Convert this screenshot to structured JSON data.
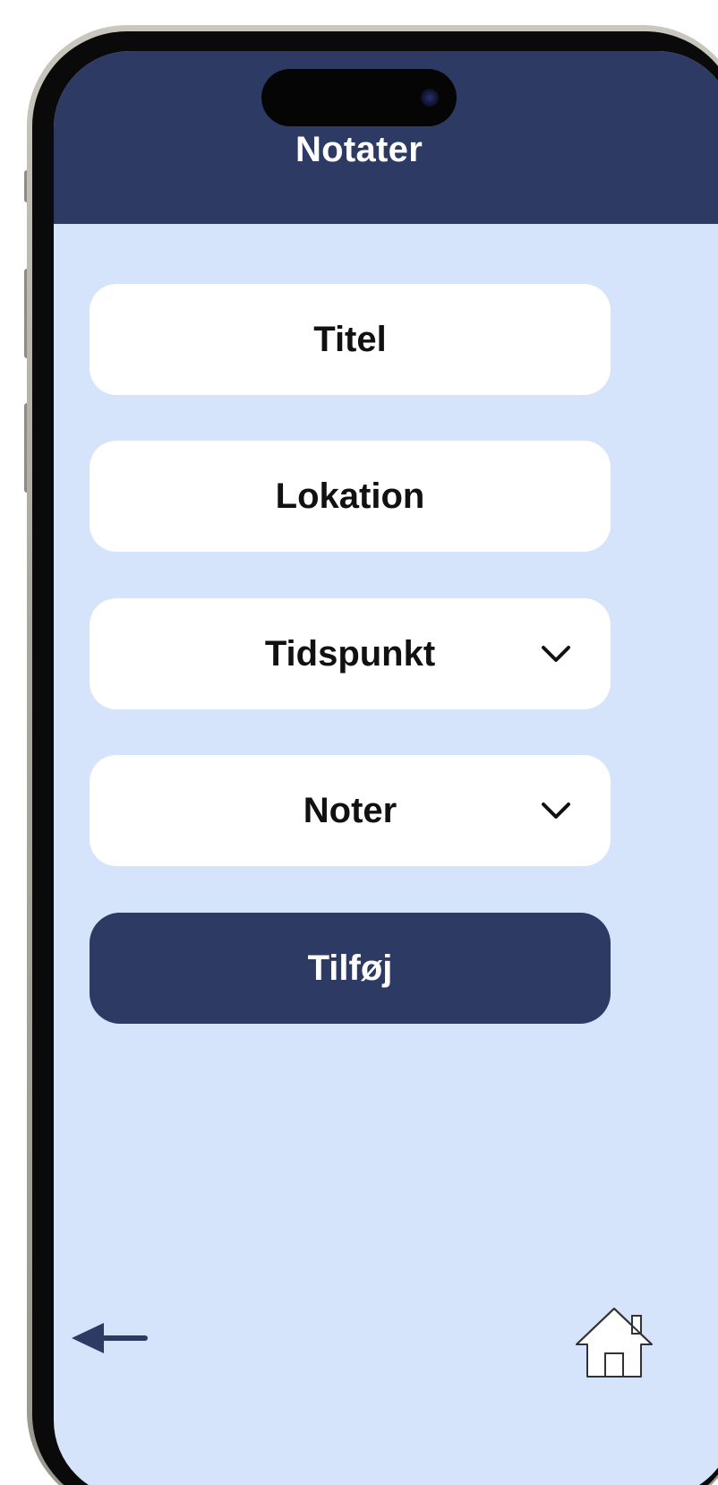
{
  "header": {
    "title": "Notater"
  },
  "form": {
    "fields": [
      {
        "label": "Titel",
        "has_dropdown": false
      },
      {
        "label": "Lokation",
        "has_dropdown": false
      },
      {
        "label": "Tidspunkt",
        "has_dropdown": true
      },
      {
        "label": "Noter",
        "has_dropdown": true
      }
    ],
    "submit_label": "Tilføj"
  },
  "nav": {
    "back_icon": "arrow-left-icon",
    "home_icon": "home-icon"
  },
  "colors": {
    "header_bg": "#2d3a63",
    "screen_bg": "#d6e4fb",
    "field_bg": "#ffffff",
    "button_bg": "#2d3a63",
    "button_text": "#ffffff",
    "label_text": "#111111"
  }
}
